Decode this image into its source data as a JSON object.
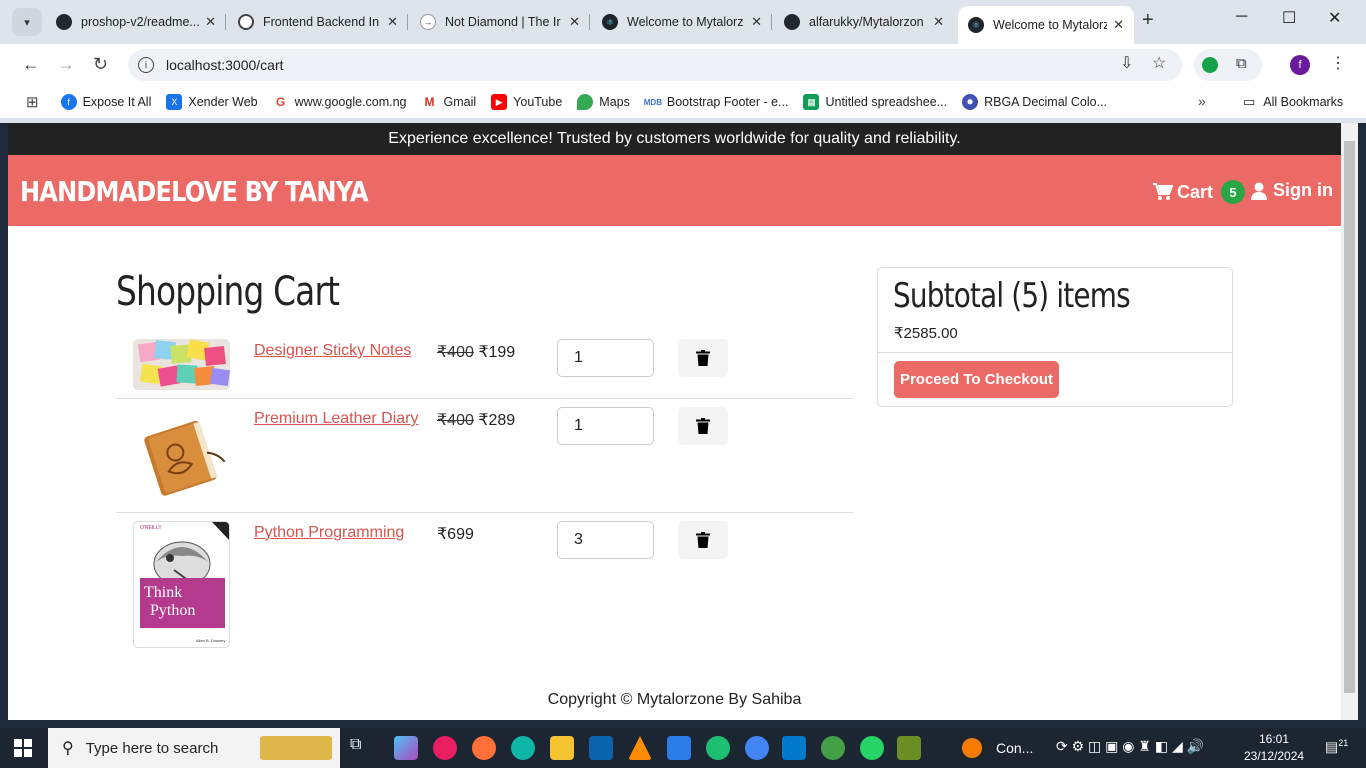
{
  "browser": {
    "tabs": [
      {
        "title": "proshop-v2/readme...",
        "icon": "github-icon",
        "active": false
      },
      {
        "title": "Frontend Backend In",
        "icon": "chatgpt-icon",
        "active": false
      },
      {
        "title": "Not Diamond | The Ir",
        "icon": "notdiamond-icon",
        "active": false
      },
      {
        "title": "Welcome to Mytalorz",
        "icon": "react-icon",
        "active": false
      },
      {
        "title": "alfarukky/Mytalorzon",
        "icon": "github-icon",
        "active": false
      },
      {
        "title": "Welcome to Mytalorz",
        "icon": "react-icon",
        "active": true
      }
    ],
    "url": "localhost:3000/cart",
    "profile_initial": "f",
    "bookmarks": [
      {
        "label": "Expose It All",
        "icon": "facebook-icon",
        "color": "#1877f2"
      },
      {
        "label": "Xender Web",
        "icon": "xender-icon",
        "color": "#1a73e8"
      },
      {
        "label": "www.google.com.ng",
        "icon": "google-icon",
        "color": "#ea4335"
      },
      {
        "label": "Gmail",
        "icon": "gmail-icon",
        "color": "#d93025"
      },
      {
        "label": "YouTube",
        "icon": "youtube-icon",
        "color": "#ff0000"
      },
      {
        "label": "Maps",
        "icon": "maps-icon",
        "color": "#34a853"
      },
      {
        "label": "Bootstrap Footer - e...",
        "icon": "mdb-icon",
        "color": "#3b71ca"
      },
      {
        "label": "Untitled spreadshee...",
        "icon": "sheets-icon",
        "color": "#0f9d58"
      },
      {
        "label": "RBGA Decimal Colo...",
        "icon": "rgba-icon",
        "color": "#3f51b5"
      }
    ],
    "all_bookmarks": "All Bookmarks"
  },
  "site": {
    "promo": "Experience excellence! Trusted by customers worldwide for quality and reliability.",
    "brand": "HANDMADELOVE BY TANYA",
    "cart_label": "Cart",
    "cart_count": "5",
    "signin_label": "Sign in",
    "accent": "#ec6a65"
  },
  "cart": {
    "title": "Shopping Cart",
    "items": [
      {
        "name": "Designer Sticky Notes",
        "old_price": "₹400",
        "price": "₹199",
        "qty": "1"
      },
      {
        "name": "Premium Leather Diary",
        "old_price": "₹400",
        "price": "₹289",
        "qty": "1"
      },
      {
        "name": "Python Programming",
        "old_price": "",
        "price": "₹699",
        "qty": "3"
      }
    ]
  },
  "summary": {
    "title": "Subtotal (5) items",
    "total": "₹2585.00",
    "checkout_label": "Proceed To Checkout"
  },
  "footer": {
    "text": "Copyright © Mytalorzone By Sahiba"
  },
  "book_cover": {
    "publisher": "O'REILLY",
    "title_line1": "Think",
    "title_line2": "Python",
    "author": "Allen B. Downey"
  },
  "taskbar": {
    "search_placeholder": "Type here to search",
    "running_app": "Con...",
    "time": "16:01",
    "date": "23/12/2024",
    "notifications": "21"
  }
}
